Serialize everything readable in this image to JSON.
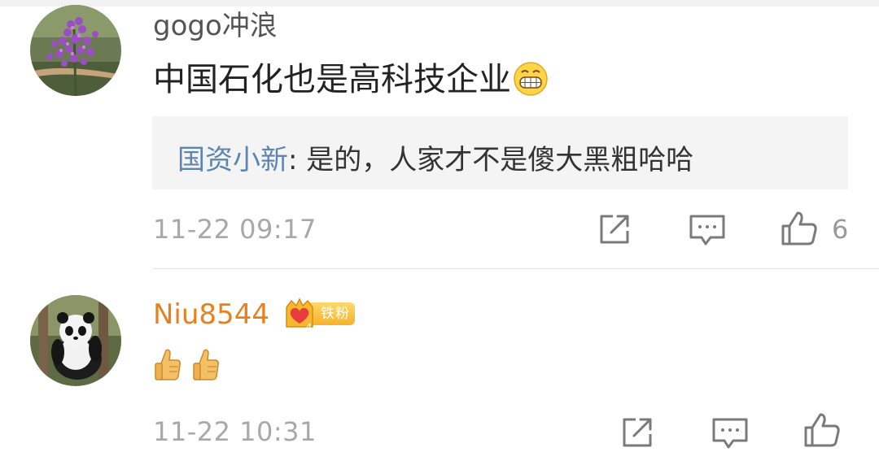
{
  "comments": [
    {
      "username": "gogo冲浪",
      "avatar": "purple-flowers-avatar",
      "text": "中国石化也是高科技企业",
      "emoji": "grin-emoji",
      "reply": {
        "name": "国资小新",
        "separator": ": ",
        "text": "是的，人家才不是傻大黑粗哈哈"
      },
      "timestamp": "11-22 09:17",
      "like_count": "6"
    },
    {
      "username": "Niu8544",
      "avatar": "panda-avatar",
      "badge_label": "铁粉",
      "badge_level": "4",
      "emojis": [
        "thumbs-up-emoji",
        "thumbs-up-emoji"
      ],
      "timestamp": "11-22 10:31",
      "like_count": ""
    }
  ],
  "colors": {
    "username_normal": "#555555",
    "username_fan": "#e8801e",
    "reply_name": "#5d85b0",
    "timestamp": "#a8a8a8",
    "reply_bg": "#f4f4f4",
    "divider": "#e2e2e2"
  },
  "icons": [
    "share-icon",
    "comment-icon",
    "like-icon"
  ]
}
